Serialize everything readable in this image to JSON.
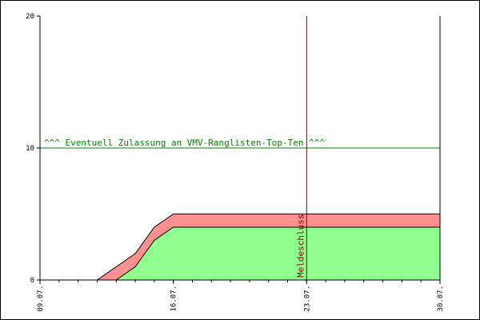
{
  "chart_data": {
    "type": "area",
    "title": "",
    "xlabel": "",
    "ylabel": "",
    "x_tick_labels": [
      "09.07.",
      "16.07.",
      "23.07.",
      "30.07."
    ],
    "x_range": [
      "2024-07-09",
      "2024-07-30"
    ],
    "ylim": [
      0,
      20
    ],
    "y_ticks": [
      0,
      10,
      20
    ],
    "grid": false,
    "legend": "none",
    "x": [
      "2024-07-09",
      "2024-07-10",
      "2024-07-11",
      "2024-07-12",
      "2024-07-13",
      "2024-07-14",
      "2024-07-15",
      "2024-07-16",
      "2024-07-17",
      "2024-07-18",
      "2024-07-19",
      "2024-07-20",
      "2024-07-21",
      "2024-07-22",
      "2024-07-23",
      "2024-07-24",
      "2024-07-25",
      "2024-07-26",
      "2024-07-27",
      "2024-07-28",
      "2024-07-29",
      "2024-07-30"
    ],
    "series": [
      {
        "color": "#90ff90",
        "values": [
          0,
          0,
          0,
          0,
          0,
          1,
          3,
          4,
          4,
          4,
          4,
          4,
          4,
          4,
          4,
          4,
          4,
          4,
          4,
          4,
          4,
          4
        ]
      },
      {
        "color": "#ff9090",
        "values": [
          0,
          0,
          0,
          0,
          1,
          2,
          4,
          5,
          5,
          5,
          5,
          5,
          5,
          5,
          5,
          5,
          5,
          5,
          5,
          5,
          5,
          5
        ]
      }
    ],
    "annotations": {
      "threshold": {
        "value": 10,
        "text": "^^^ Eventuell Zulassung an VMV-Ranglisten-Top-Ten ^^^",
        "color": "#008000"
      },
      "deadline": {
        "x": "2024-07-23",
        "text": "Meldeschluss",
        "color": "#800000"
      }
    }
  }
}
